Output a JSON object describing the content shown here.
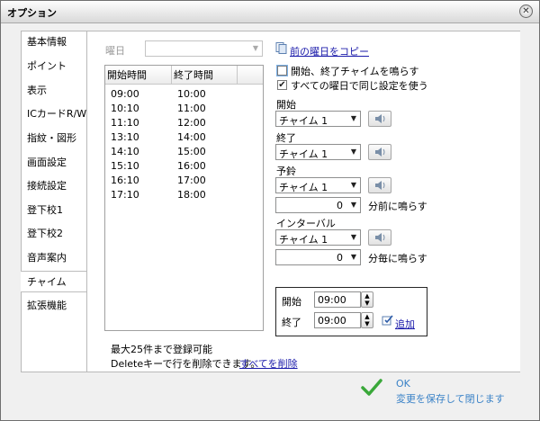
{
  "window": {
    "title": "オプション"
  },
  "nav": {
    "items": [
      "基本情報",
      "ポイント",
      "表示",
      "ICカードR/W",
      "指紋・図形",
      "画面設定",
      "接続設定",
      "登下校1",
      "登下校2",
      "音声案内",
      "チャイム",
      "拡張機能"
    ],
    "active": "チャイム"
  },
  "weekday": {
    "label": "曜日",
    "value": ""
  },
  "copy_prev": "前の曜日をコピー",
  "list": {
    "headers": [
      "開始時間",
      "終了時間"
    ],
    "rows": [
      [
        "09:00",
        "10:00"
      ],
      [
        "10:10",
        "11:00"
      ],
      [
        "11:10",
        "12:00"
      ],
      [
        "13:10",
        "14:00"
      ],
      [
        "14:10",
        "15:00"
      ],
      [
        "15:10",
        "16:00"
      ],
      [
        "16:10",
        "17:00"
      ],
      [
        "17:10",
        "18:00"
      ]
    ]
  },
  "options": {
    "ring_start_end": {
      "label": "開始、終了チャイムを鳴らす",
      "checked": false
    },
    "same_all_days": {
      "label": "すべての曜日で同じ設定を使う",
      "checked": true
    }
  },
  "chimes": {
    "start": {
      "label": "開始",
      "value": "チャイム 1"
    },
    "end": {
      "label": "終了",
      "value": "チャイム 1"
    },
    "warning": {
      "label": "予鈴",
      "value": "チャイム 1",
      "minutes": "0",
      "unit": "分前に鳴らす"
    },
    "interval": {
      "label": "インターバル",
      "value": "チャイム 1",
      "minutes": "0",
      "unit": "分毎に鳴らす"
    }
  },
  "add_box": {
    "start_label": "開始",
    "start_value": "09:00",
    "end_label": "終了",
    "end_value": "09:00",
    "add_label": "追加"
  },
  "footer": {
    "max_note": "最大25件まで登録可能",
    "delete_note": "Deleteキーで行を削除できます。",
    "delete_all": "すべてを削除"
  },
  "ok": {
    "label": "OK",
    "sub": "変更を保存して閉じます"
  },
  "colors": {
    "link": "#1a1aaa",
    "ok_text": "#3a82c7",
    "ok_check": "#3aa83a"
  }
}
